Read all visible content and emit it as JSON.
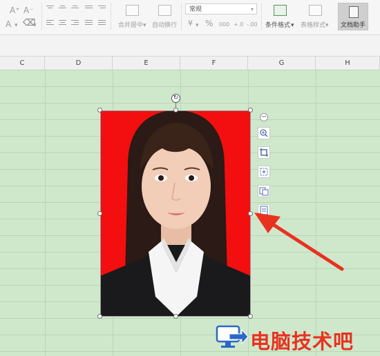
{
  "ribbon": {
    "font_size_up": "A⁺",
    "font_size_down": "A⁻",
    "font_color": "A",
    "merge_center_label": "合并居中",
    "wrap_text_label": "自动换行",
    "number_format_value": "常规",
    "percent_symbol": "%",
    "thousands_symbol": "000",
    "decimal_increase": "+.0",
    "decimal_decrease": "-.00",
    "currency_symbol": "¥",
    "conditional_format_label": "条件格式",
    "table_style_label": "表格样式",
    "doc_helper_label": "文档助手",
    "dropdown_arrow": "▾"
  },
  "columns": [
    "C",
    "D",
    "E",
    "F",
    "G",
    "H"
  ],
  "image_toolbar": {
    "collapse_symbol": "−",
    "buttons": [
      "zoom-in-icon",
      "crop-icon",
      "cutout-icon",
      "extract-image-icon",
      "compress-icon"
    ]
  },
  "watermark": {
    "text": "电脑技术吧"
  },
  "colors": {
    "grid_bg": "#cfe8cc",
    "photo_bg": "#f30f0f",
    "arrow": "#e8321f",
    "watermark": "#e8321f"
  }
}
